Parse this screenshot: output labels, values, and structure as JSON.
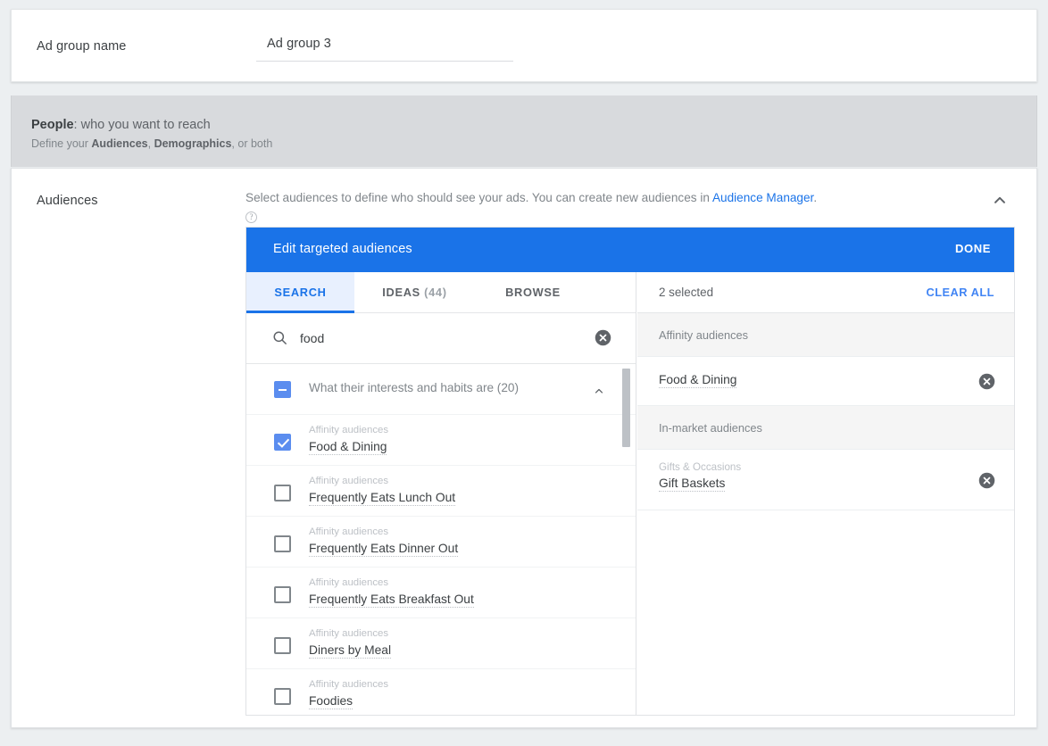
{
  "adgroup": {
    "label": "Ad group name",
    "value": "Ad group 3",
    "placeholder": "Ad group name"
  },
  "people": {
    "title_bold": "People",
    "title_rest": ": who you want to reach",
    "sub_prefix": "Define your ",
    "sub_b1": "Audiences",
    "sub_mid": ", ",
    "sub_b2": "Demographics",
    "sub_suffix": ", or both"
  },
  "audiences": {
    "label": "Audiences",
    "help_text": "Select audiences to define who should see your ads.  You can create new audiences in ",
    "help_link": "Audience Manager",
    "help_period": ".",
    "help_icon": "help-icon",
    "collapse_icon": "chevron-up-icon"
  },
  "dialog": {
    "title": "Edit targeted audiences",
    "done_label": "DONE",
    "tabs": [
      {
        "label": "SEARCH",
        "count": "",
        "active": true
      },
      {
        "label": "IDEAS",
        "count": "(44)",
        "active": false
      },
      {
        "label": "BROWSE",
        "count": "",
        "active": false
      }
    ],
    "search": {
      "value": "food",
      "placeholder": "Search",
      "search_icon": "search-icon",
      "clear_icon": "clear-circle-icon"
    },
    "group": {
      "label": "What their interests and habits are (20)",
      "checkbox_state": "indeterminate",
      "chevron": "chevron-up-icon"
    },
    "items": [
      {
        "category": "Affinity audiences",
        "name": "Food & Dining",
        "checked": true
      },
      {
        "category": "Affinity audiences",
        "name": "Frequently Eats Lunch Out",
        "checked": false
      },
      {
        "category": "Affinity audiences",
        "name": "Frequently Eats Dinner Out",
        "checked": false
      },
      {
        "category": "Affinity audiences",
        "name": "Frequently Eats Breakfast Out",
        "checked": false
      },
      {
        "category": "Affinity audiences",
        "name": "Diners by Meal",
        "checked": false
      },
      {
        "category": "Affinity audiences",
        "name": "Foodies",
        "checked": false
      }
    ],
    "selected_panel": {
      "count_label": "2 selected",
      "clear_all_label": "CLEAR ALL",
      "groups": [
        {
          "header": "Affinity audiences",
          "items": [
            {
              "category": "",
              "name": "Food & Dining",
              "remove_icon": "remove-circle-icon"
            }
          ]
        },
        {
          "header": "In-market audiences",
          "items": [
            {
              "category": "Gifts & Occasions",
              "name": "Gift Baskets",
              "remove_icon": "remove-circle-icon"
            }
          ]
        }
      ]
    }
  },
  "colors": {
    "accent_blue": "#1a73e8",
    "link_blue": "#4285f4",
    "tab_active_bg": "#e8f0fe",
    "checkbox_blue": "#5b8def",
    "band_gray": "#d8dadd",
    "panel_gray": "#f5f5f5"
  }
}
